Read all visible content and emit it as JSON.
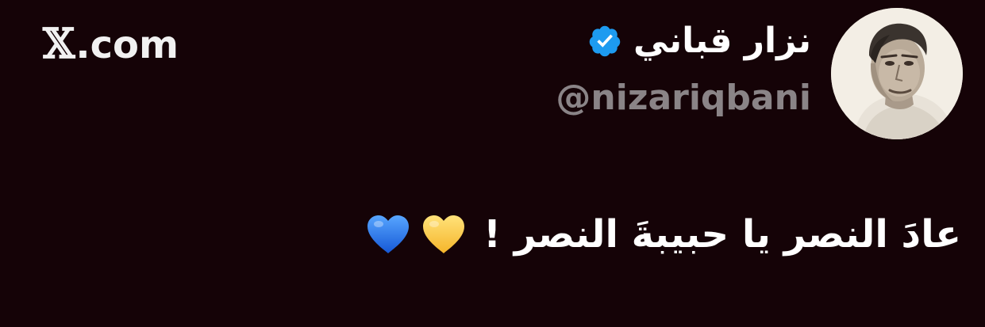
{
  "brand": {
    "logo_glyph": "𝕏",
    "domain_text": ".com"
  },
  "profile": {
    "display_name": "نزار قباني",
    "handle": "@nizariqbani",
    "verified_color": "#1d9bf0",
    "avatar_icon": "profile-photo"
  },
  "tweet": {
    "text": "عادَ النصر يا حبيبةَ النصر !",
    "emoji": [
      {
        "name": "yellow-heart-icon",
        "color": "#ffc83d"
      },
      {
        "name": "blue-heart-icon",
        "color": "#1a73e8"
      }
    ]
  },
  "colors": {
    "background": "#150307",
    "primary_text": "#ffffff",
    "secondary_text": "#8a8487"
  }
}
